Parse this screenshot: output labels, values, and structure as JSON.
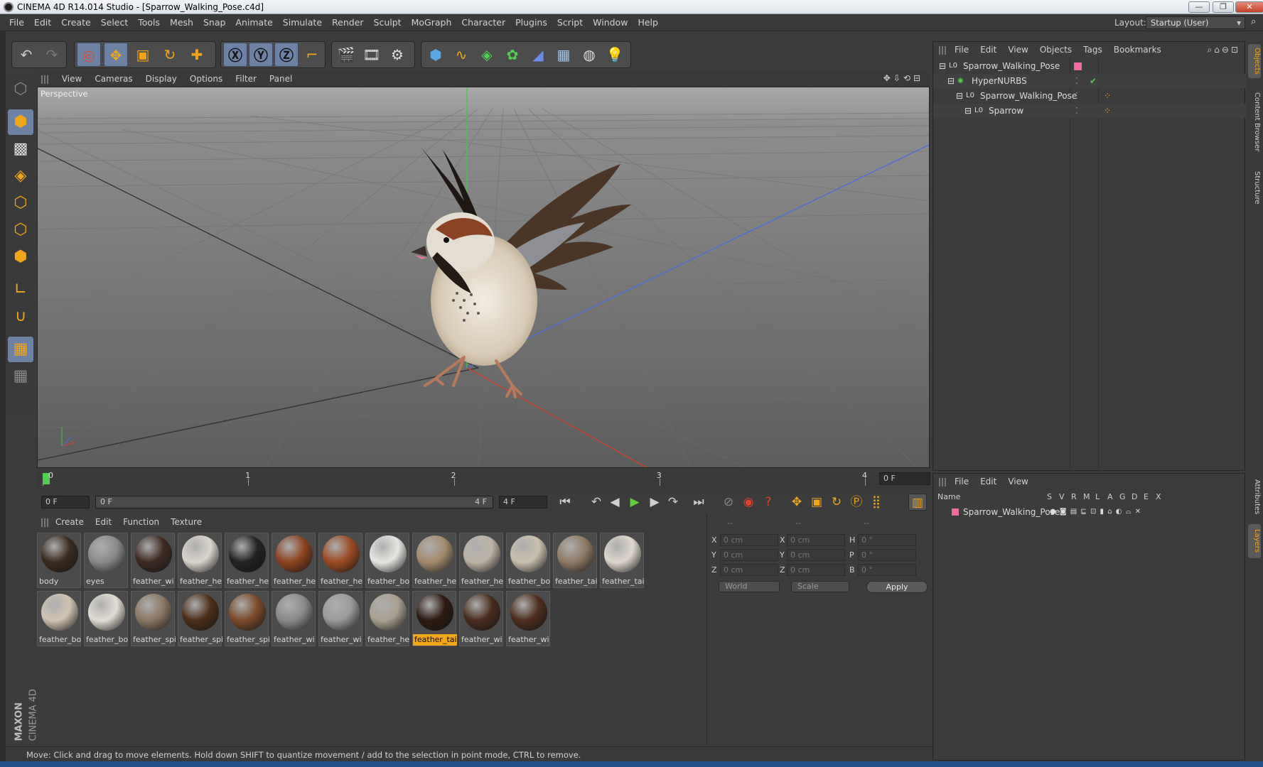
{
  "window": {
    "title": "CINEMA 4D R14.014 Studio - [Sparrow_Walking_Pose.c4d]",
    "minimize": "—",
    "restore": "❐",
    "close": "✕"
  },
  "menu": {
    "items": [
      "File",
      "Edit",
      "Create",
      "Select",
      "Tools",
      "Mesh",
      "Snap",
      "Animate",
      "Simulate",
      "Render",
      "Sculpt",
      "MoGraph",
      "Character",
      "Plugins",
      "Script",
      "Window",
      "Help"
    ],
    "layout_label": "Layout:",
    "layout_value": "Startup (User)"
  },
  "viewport": {
    "menu": [
      "View",
      "Cameras",
      "Display",
      "Options",
      "Filter",
      "Panel"
    ],
    "camera_label": "Perspective",
    "axes": {
      "x_color": "#d2402f",
      "y_color": "#3fcc3f",
      "z_color": "#4c6be0"
    }
  },
  "timeline": {
    "ticks": [
      "0",
      "1",
      "2",
      "3",
      "4"
    ],
    "current_frame": "0 F"
  },
  "transport": {
    "start_field": "0 F",
    "range_start": "0 F",
    "range_end": "4 F",
    "end_field": "4 F"
  },
  "materials": {
    "menu": [
      "Create",
      "Edit",
      "Function",
      "Texture"
    ],
    "items": [
      {
        "label": "body",
        "color": "#3a2b1f"
      },
      {
        "label": "eyes",
        "color": "#8a8a8a"
      },
      {
        "label": "feather_wi",
        "color": "#3d2a22"
      },
      {
        "label": "feather_he",
        "color": "#d9d4cc"
      },
      {
        "label": "feather_he",
        "color": "#222222"
      },
      {
        "label": "feather_he",
        "color": "#8c4320"
      },
      {
        "label": "feather_he",
        "color": "#9b4a23"
      },
      {
        "label": "feather_bo",
        "color": "#e8e6e2"
      },
      {
        "label": "feather_he",
        "color": "#a48a6c"
      },
      {
        "label": "feather_he",
        "color": "#bdb3a6"
      },
      {
        "label": "feather_bo",
        "color": "#c9bfae"
      },
      {
        "label": "feather_tai",
        "color": "#8f7a64"
      },
      {
        "label": "feather_tai",
        "color": "#ddd6cc"
      },
      {
        "label": "feather_bo",
        "color": "#cfc3b1"
      },
      {
        "label": "feather_bo",
        "color": "#e2ddd3"
      },
      {
        "label": "feather_spi",
        "color": "#8a7663"
      },
      {
        "label": "feather_spi",
        "color": "#4d2e18"
      },
      {
        "label": "feather_spi",
        "color": "#7a4a28"
      },
      {
        "label": "feather_wi",
        "color": "#8a8a8a"
      },
      {
        "label": "feather_wi",
        "color": "#9a9a9a"
      },
      {
        "label": "feather_he",
        "color": "#a8a090"
      },
      {
        "label": "feather_tai",
        "color": "#2d1a12"
      },
      {
        "label": "feather_wi",
        "color": "#4a2c1e"
      },
      {
        "label": "feather_wi",
        "color": "#4e2d1d"
      }
    ],
    "selected_index": 21
  },
  "coordinates": {
    "header": [
      "--",
      "--",
      "--"
    ],
    "rows": [
      {
        "a": "X",
        "av": "0 cm",
        "b": "X",
        "bv": "0 cm",
        "c": "H",
        "cv": "0 °"
      },
      {
        "a": "Y",
        "av": "0 cm",
        "b": "Y",
        "bv": "0 cm",
        "c": "P",
        "cv": "0 °"
      },
      {
        "a": "Z",
        "av": "0 cm",
        "b": "Z",
        "bv": "0 cm",
        "c": "B",
        "cv": "0 °"
      }
    ],
    "mode": "World",
    "type": "Scale",
    "apply": "Apply"
  },
  "objects": {
    "menu": [
      "File",
      "Edit",
      "View",
      "Objects",
      "Tags",
      "Bookmarks"
    ],
    "tree": [
      {
        "name": "Sparrow_Walking_Pose",
        "indent": 0,
        "icon": "L0"
      },
      {
        "name": "HyperNURBS",
        "indent": 1,
        "icon": "◉"
      },
      {
        "name": "Sparrow_Walking_Pose",
        "indent": 2,
        "icon": "L0"
      },
      {
        "name": "Sparrow",
        "indent": 3,
        "icon": "L0"
      }
    ],
    "layer_color": "#f06aa0",
    "check": "✔"
  },
  "layers": {
    "menu": [
      "File",
      "Edit",
      "View"
    ],
    "columns": [
      "Name",
      "S",
      "V",
      "R",
      "M",
      "L",
      "A",
      "G",
      "D",
      "E",
      "X"
    ],
    "rows": [
      {
        "name": "Sparrow_Walking_Pose",
        "color": "#f06aa0"
      }
    ]
  },
  "side_tabs": [
    "Objects",
    "Content Browser",
    "Structure",
    "Attributes",
    "Layers"
  ],
  "status": "Move: Click and drag to move elements. Hold down SHIFT to quantize movement / add to the selection in point mode, CTRL to remove.",
  "brand": {
    "line1": "MAXON",
    "line2": "CINEMA 4D"
  },
  "colors": {
    "accent": "#f0a51a",
    "selection": "#6e82a6",
    "panel": "#3c3c3c"
  }
}
